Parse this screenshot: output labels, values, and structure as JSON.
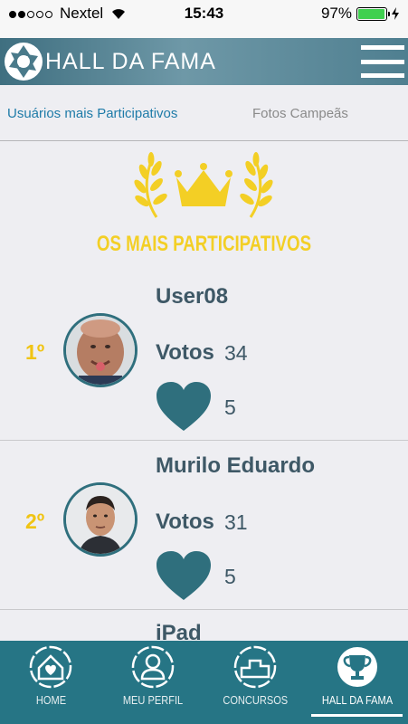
{
  "status_bar": {
    "carrier": "Nextel",
    "time": "15:43",
    "battery": "97%",
    "battery_level": 0.97,
    "signal_bars_filled": 2,
    "signal_bars_total": 5
  },
  "header": {
    "title": "HALL DA FAMA",
    "logo_icon": "camera-shutter-icon",
    "menu_icon": "hamburger-menu-icon"
  },
  "tabs": [
    {
      "label": "Usuários mais Participativos",
      "active": true
    },
    {
      "label": "Fotos Campeãs",
      "active": false
    }
  ],
  "hero": {
    "title": "OS MAIS PARTICIPATIVOS",
    "icon": "crown-laurel-icon"
  },
  "ranking": [
    {
      "rank": "1º",
      "name": "User08",
      "votes_label": "Votos",
      "votes": "34",
      "likes": "5",
      "like_icon": "heart-icon"
    },
    {
      "rank": "2º",
      "name": "Murilo Eduardo",
      "votes_label": "Votos",
      "votes": "31",
      "likes": "5",
      "like_icon": "heart-icon"
    },
    {
      "name": "iPad"
    }
  ],
  "bottom_nav": [
    {
      "label": "HOME",
      "icon": "home-heart-icon",
      "active": false
    },
    {
      "label": "MEU PERFIL",
      "icon": "user-profile-icon",
      "active": false
    },
    {
      "label": "CONCURSOS",
      "icon": "podium-icon",
      "active": false
    },
    {
      "label": "HALL DA FAMA",
      "icon": "trophy-icon",
      "active": true
    }
  ],
  "colors": {
    "accent_yellow": "#f3cf25",
    "teal": "#267585",
    "tab_active": "#1e7ba8",
    "text_dark": "#3e5866"
  }
}
